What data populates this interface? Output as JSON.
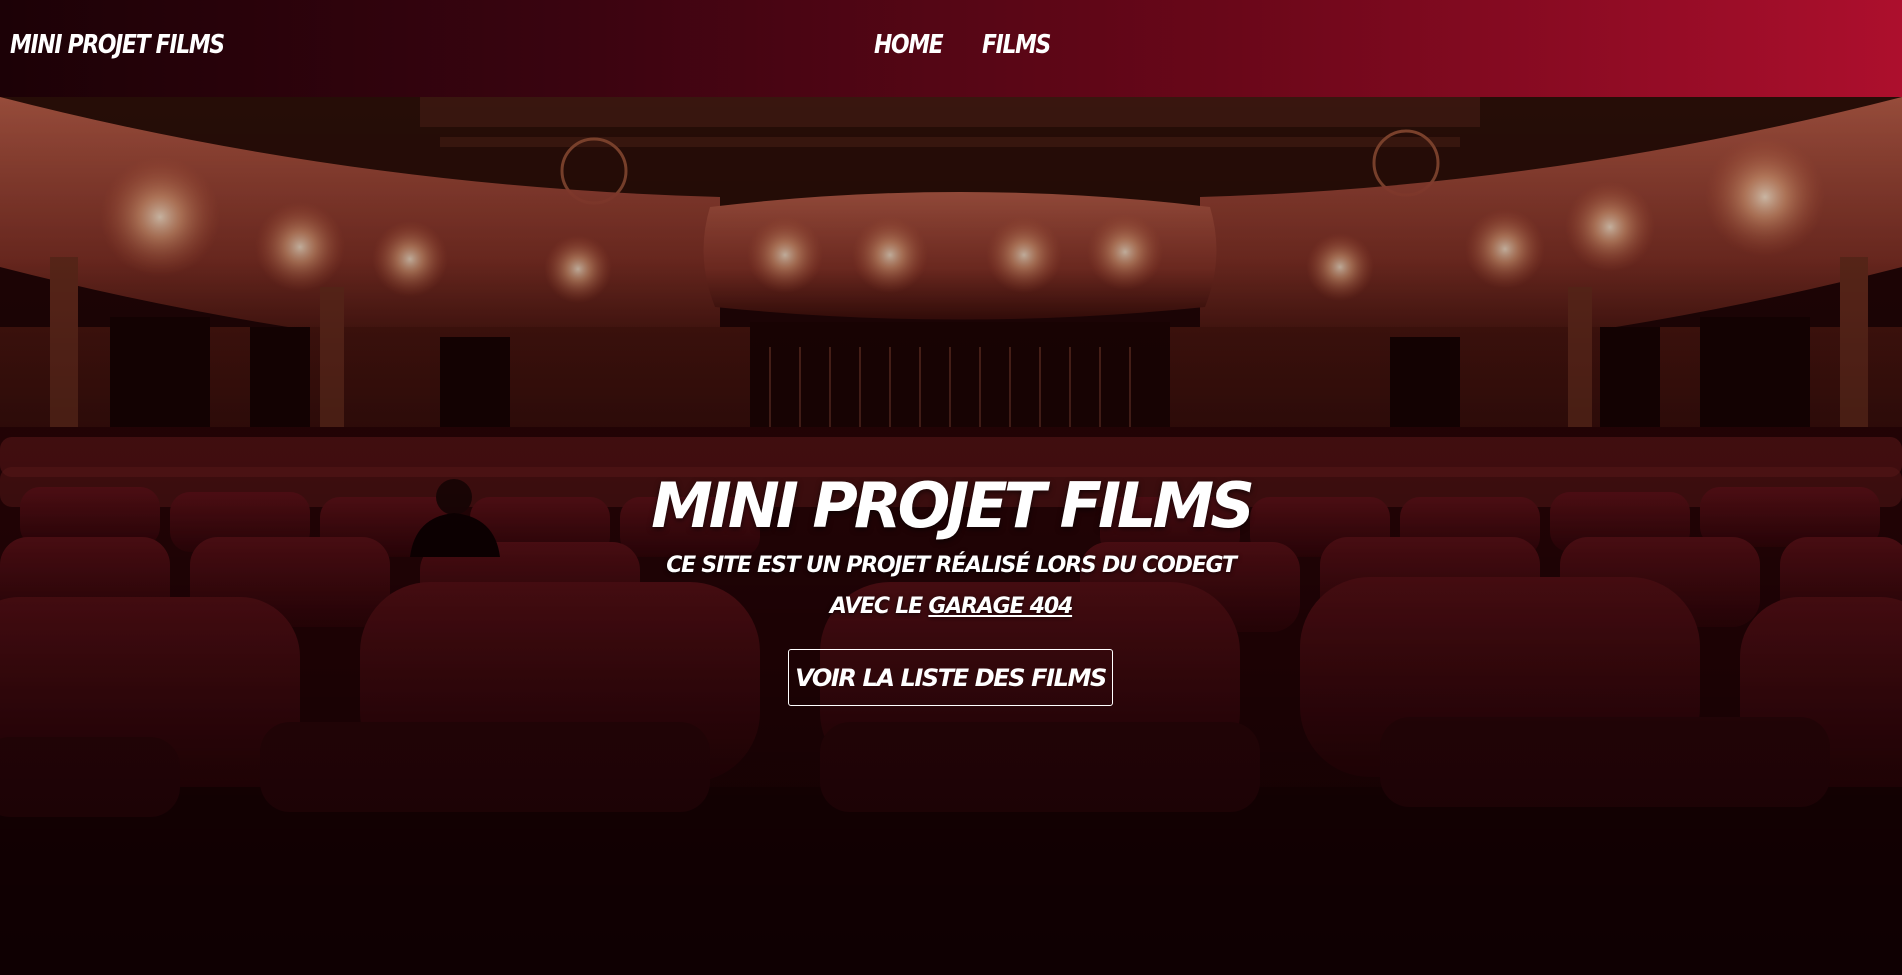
{
  "header": {
    "brand": "MINI PROJET FILMS",
    "nav": [
      "HOME",
      "FILMS"
    ]
  },
  "hero": {
    "title": "MINI PROJET FILMS",
    "subtitle_line1": "CE SITE EST UN PROJET RÉALISÉ LORS DU CODEGT",
    "subtitle_line2_prefix": "AVEC LE ",
    "subtitle_link": "GARAGE 404",
    "cta_label": "VOIR LA LISTE DES FILMS",
    "background_image": "cinema-theater-red-seats"
  },
  "colors": {
    "header_start": "#1c0106",
    "header_end": "#ad0f2d",
    "text": "#ffffff"
  }
}
